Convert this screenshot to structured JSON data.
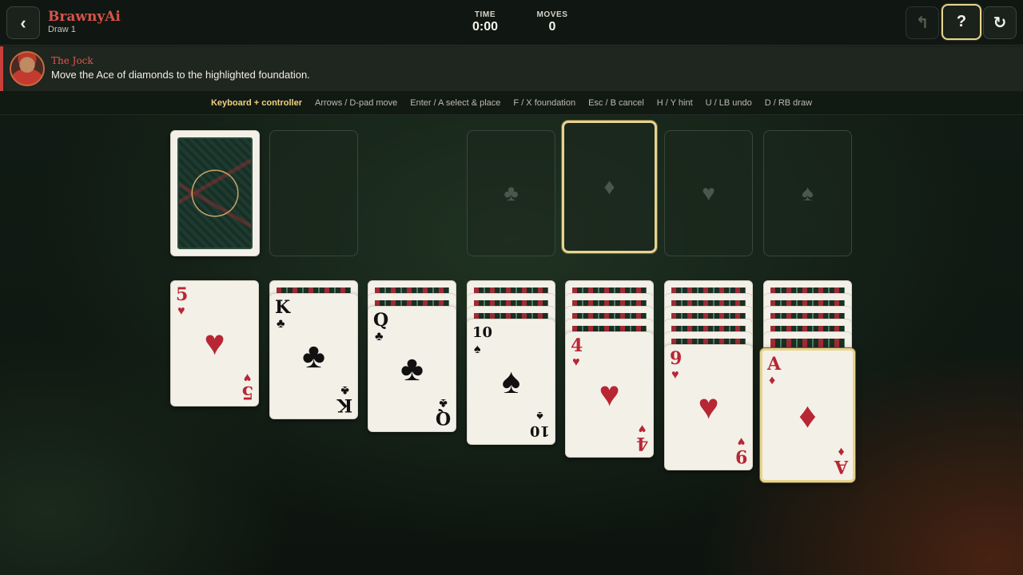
{
  "header": {
    "back_icon": "‹",
    "title": "BrawnyAi",
    "subtitle": "Draw 1",
    "time_label": "TIME",
    "time_value": "0:00",
    "moves_label": "MOVES",
    "moves_value": "0",
    "undo_icon": "↰",
    "help_icon": "?",
    "restart_icon": "↻"
  },
  "hint": {
    "coach_name": "The Jock",
    "message": "Move the Ace of diamonds to the highlighted foundation."
  },
  "controls": {
    "title": "Keyboard + controller",
    "items": [
      "Arrows / D-pad move",
      "Enter / A select & place",
      "F / X foundation",
      "Esc / B cancel",
      "H / Y hint",
      "U / LB undo",
      "D / RB draw"
    ]
  },
  "foundations": [
    {
      "suit": "♣",
      "highlighted": false
    },
    {
      "suit": "♦",
      "highlighted": true
    },
    {
      "suit": "♥",
      "highlighted": false
    },
    {
      "suit": "♠",
      "highlighted": false
    }
  ],
  "tableau": [
    {
      "facedown": 0,
      "rank": "5",
      "suit": "♥",
      "color": "red"
    },
    {
      "facedown": 1,
      "rank": "K",
      "suit": "♣",
      "color": "black"
    },
    {
      "facedown": 2,
      "rank": "Q",
      "suit": "♣",
      "color": "black"
    },
    {
      "facedown": 3,
      "rank": "10",
      "suit": "♠",
      "color": "black"
    },
    {
      "facedown": 4,
      "rank": "4",
      "suit": "♥",
      "color": "red"
    },
    {
      "facedown": 5,
      "rank": "9",
      "suit": "♥",
      "color": "red"
    },
    {
      "facedown": 6,
      "rank": "A",
      "suit": "♦",
      "color": "red",
      "highlighted": true
    }
  ],
  "colors": {
    "accent_red": "#d9534a",
    "highlight_gold": "#e7d491",
    "card_red": "#b82634",
    "card_black": "#111111"
  }
}
